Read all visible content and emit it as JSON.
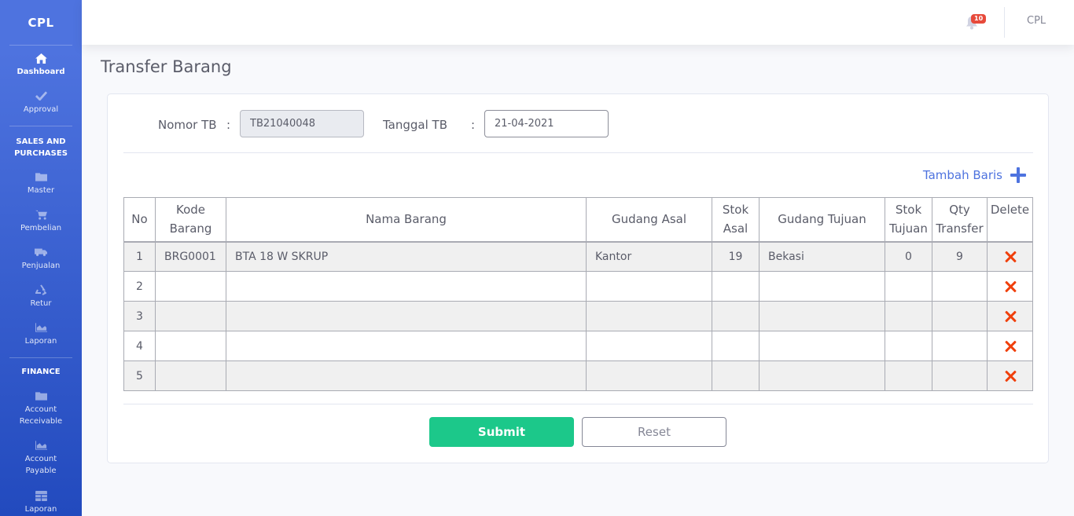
{
  "brand": "CPL",
  "sidebar": {
    "items_top": [
      {
        "label": "Dashboard",
        "icon": "home-icon"
      },
      {
        "label": "Approval",
        "icon": "check-icon"
      }
    ],
    "sales_heading": "SALES AND PURCHASES",
    "sales_items": [
      {
        "label": "Master",
        "icon": "folder-icon"
      },
      {
        "label": "Pembelian",
        "icon": "cart-icon"
      },
      {
        "label": "Penjualan",
        "icon": "truck-icon"
      },
      {
        "label": "Retur",
        "icon": "recycle-icon"
      },
      {
        "label": "Laporan",
        "icon": "chart-area-icon"
      }
    ],
    "finance_heading": "FINANCE",
    "finance_items": [
      {
        "label": "Account Receivable",
        "icon": "folder-icon"
      },
      {
        "label": "Account Payable",
        "icon": "chart-area-icon"
      },
      {
        "label": "Laporan",
        "icon": "table-icon"
      }
    ]
  },
  "topbar": {
    "notification_count": "10",
    "user_name": "CPL"
  },
  "page": {
    "title": "Transfer Barang"
  },
  "form": {
    "nomor_label": "Nomor TB",
    "nomor_colon": ":",
    "nomor_value": "TB21040048",
    "tanggal_label": "Tanggal TB",
    "tanggal_colon": ":",
    "tanggal_value": "21-04-2021",
    "add_row_label": "Tambah Baris"
  },
  "table": {
    "headers": [
      "No",
      "Kode Barang",
      "Nama Barang",
      "Gudang Asal",
      "Stok Asal",
      "Gudang Tujuan",
      "Stok Tujuan",
      "Qty Transfer",
      "Delete"
    ],
    "rows": [
      {
        "no": "1",
        "kode": "BRG0001",
        "nama": "BTA 18 W SKRUP",
        "gudang_asal": "Kantor",
        "stok_asal": "19",
        "gudang_tujuan": "Bekasi",
        "stok_tujuan": "0",
        "qty": "9"
      },
      {
        "no": "2",
        "kode": "",
        "nama": "",
        "gudang_asal": "",
        "stok_asal": "",
        "gudang_tujuan": "",
        "stok_tujuan": "",
        "qty": ""
      },
      {
        "no": "3",
        "kode": "",
        "nama": "",
        "gudang_asal": "",
        "stok_asal": "",
        "gudang_tujuan": "",
        "stok_tujuan": "",
        "qty": ""
      },
      {
        "no": "4",
        "kode": "",
        "nama": "",
        "gudang_asal": "",
        "stok_asal": "",
        "gudang_tujuan": "",
        "stok_tujuan": "",
        "qty": ""
      },
      {
        "no": "5",
        "kode": "",
        "nama": "",
        "gudang_asal": "",
        "stok_asal": "",
        "gudang_tujuan": "",
        "stok_tujuan": "",
        "qty": ""
      }
    ]
  },
  "buttons": {
    "submit": "Submit",
    "reset": "Reset"
  },
  "colors": {
    "sidebar_top": "#4e73df",
    "sidebar_bottom": "#224abe",
    "submit": "#1cc88a",
    "delete": "#f0400c",
    "badge": "#e74a3b"
  }
}
